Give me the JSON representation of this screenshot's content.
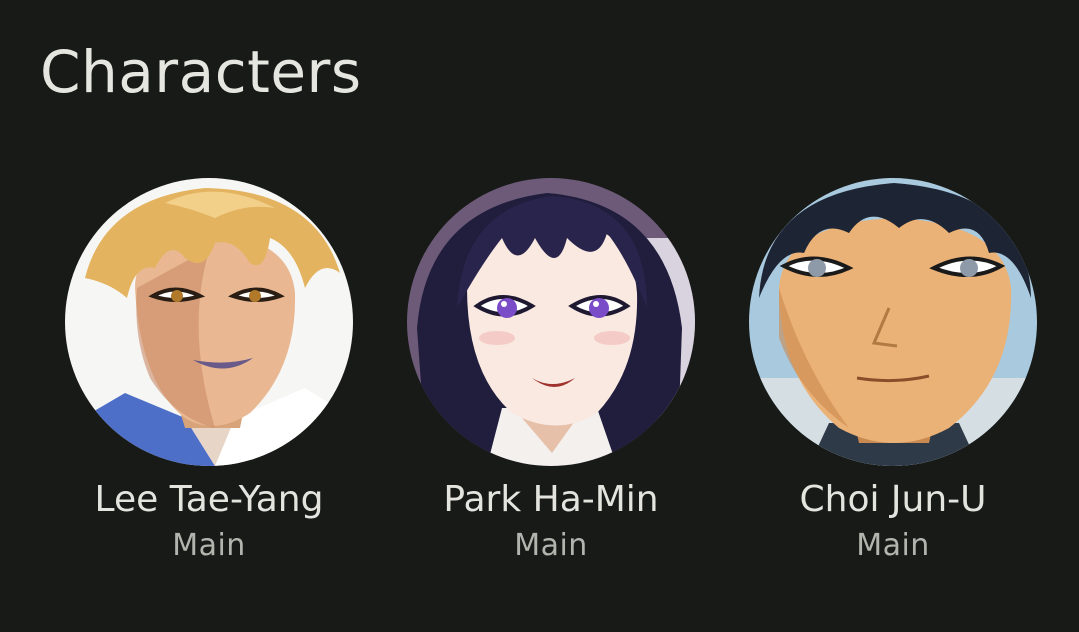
{
  "header": {
    "title": "Characters"
  },
  "characters": [
    {
      "name": "Lee Tae-Yang",
      "role": "Main",
      "avatar_icon": "portrait-avatar",
      "hair_color": "#e3b35f"
    },
    {
      "name": "Park Ha-Min",
      "role": "Main",
      "avatar_icon": "portrait-avatar",
      "hair_color": "#211d3d"
    },
    {
      "name": "Choi Jun-U",
      "role": "Main",
      "avatar_icon": "portrait-avatar",
      "hair_color": "#1d2433"
    }
  ],
  "colors": {
    "background": "#181a17",
    "title_text": "#e6e6e1",
    "secondary_text": "#b2b4ae"
  }
}
